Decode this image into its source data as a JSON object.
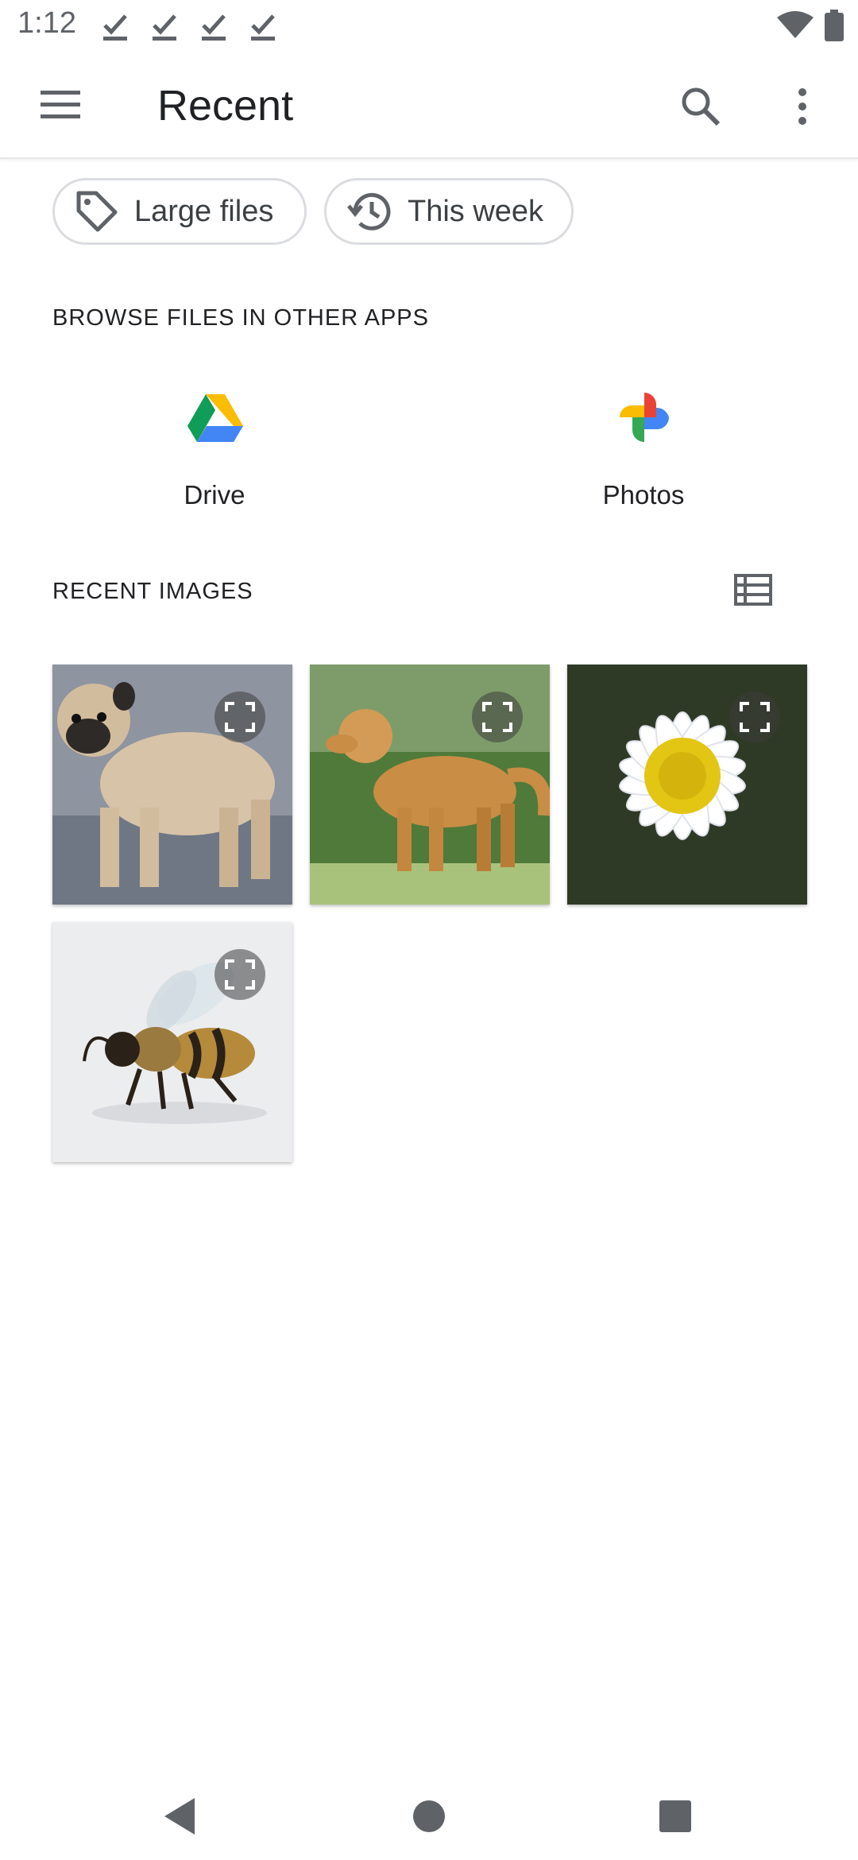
{
  "status_bar": {
    "time": "1:12",
    "icons": [
      "download-done-icon",
      "download-done-icon",
      "download-done-icon",
      "download-done-icon",
      "wifi-icon",
      "battery-icon"
    ]
  },
  "app_bar": {
    "title": "Recent",
    "icons": [
      "menu-icon",
      "search-icon",
      "more-vert-icon"
    ]
  },
  "chips": [
    {
      "label": "Large files",
      "icon": "tag-icon"
    },
    {
      "label": "This week",
      "icon": "history-icon"
    }
  ],
  "browse_section": {
    "title": "BROWSE FILES IN OTHER APPS"
  },
  "apps": [
    {
      "label": "Drive",
      "icon": "google-drive-icon"
    },
    {
      "label": "Photos",
      "icon": "google-photos-icon"
    }
  ],
  "recent_images": {
    "title": "RECENT IMAGES",
    "view_toggle_icon": "list-view-icon",
    "items": [
      {
        "subject": "pug"
      },
      {
        "subject": "golden retriever"
      },
      {
        "subject": "daisy"
      },
      {
        "subject": "bee"
      }
    ]
  },
  "colors": {
    "accent": "#1a73e8",
    "text": "#202124",
    "chip_border": "#dadce0"
  },
  "nav_bar": {
    "icons": [
      "back-icon",
      "home-icon",
      "recents-icon"
    ]
  }
}
